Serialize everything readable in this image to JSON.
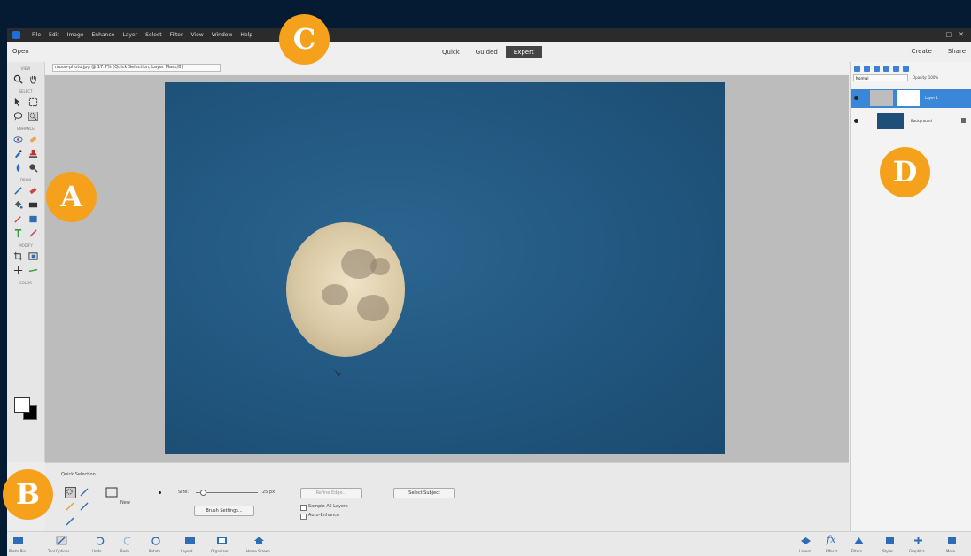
{
  "menubar": {
    "items": [
      "File",
      "Edit",
      "Image",
      "Enhance",
      "Layer",
      "Select",
      "Filter",
      "View",
      "Window",
      "Help"
    ]
  },
  "topbar": {
    "open_label": "Open",
    "modes": [
      "Quick",
      "Guided",
      "Expert"
    ],
    "active_mode": "Expert",
    "create_label": "Create",
    "share_label": "Share"
  },
  "options_bar": {
    "document_tab": "moon-photo.jpg @ 17.7% (Quick Selection, Layer Mask/8)"
  },
  "toolbox": {
    "sections": [
      "VIEW",
      "SELECT",
      "ENHANCE",
      "DRAW",
      "MODIFY",
      "COLOR"
    ]
  },
  "layers_panel": {
    "blend_mode": "Normal",
    "opacity_label": "Opacity:",
    "opacity_value": "100%",
    "layers": [
      {
        "name": "Layer 1",
        "selected": true
      },
      {
        "name": "Background",
        "selected": false
      }
    ]
  },
  "tool_options": {
    "tool_name": "Quick Selection",
    "new_label": "New",
    "size_label": "Size:",
    "size_value": "25 px",
    "brush_settings": "Brush Settings...",
    "refine_edge": "Refine Edge...",
    "select_subject": "Select Subject",
    "sample_all_layers": "Sample All Layers",
    "auto_enhance": "Auto-Enhance"
  },
  "taskbar": {
    "left_items": [
      "Photo Bin",
      "Tool Options",
      "Undo",
      "Redo",
      "Rotate",
      "Layout",
      "Organizer",
      "Home Screen"
    ],
    "right_items": [
      "Layers",
      "Effects",
      "Filters",
      "Styles",
      "Graphics",
      "More"
    ]
  },
  "callouts": [
    "A",
    "B",
    "C",
    "D"
  ],
  "colors": {
    "callout": "#f5a11c",
    "selection": "#3a86d8",
    "sky": "#20557d"
  }
}
